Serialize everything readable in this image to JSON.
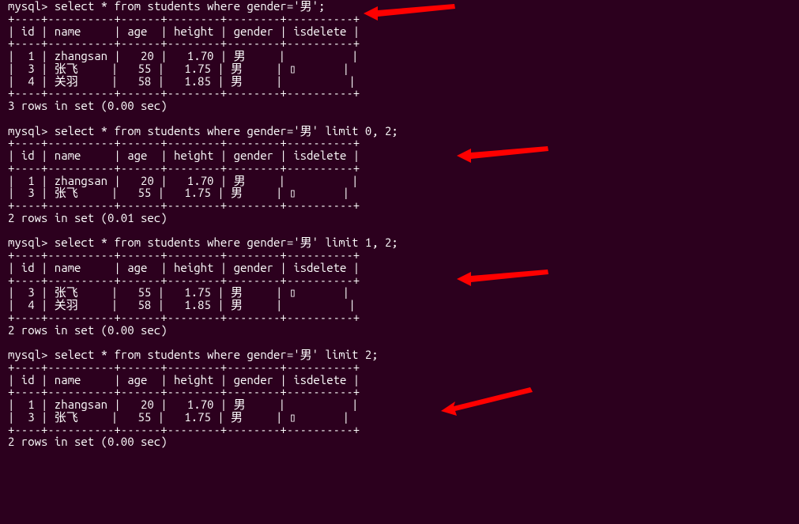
{
  "prompt": "mysql>",
  "queries": {
    "q1": "select * from students where gender='男';",
    "q2": "select * from students where gender='男' limit 0, 2;",
    "q3": "select * from students where gender='男' limit 1, 2;",
    "q4": "select * from students where gender='男' limit 2;"
  },
  "table_sep": "+----+----------+------+--------+--------+----------+",
  "table_hdr": "| id | name     | age  | height | gender | isdelete |",
  "rows": {
    "r1": "|  1 | zhangsan |   20 |   1.70 | 男     |          |",
    "r3": "|  3 | 张飞     |   55 |   1.75 | 男     | ▯       |",
    "r4": "|  4 | 关羽     |   58 |   1.85 | 男     |          |"
  },
  "footers": {
    "f3_000": "3 rows in set (0.00 sec)",
    "f2_001": "2 rows in set (0.01 sec)",
    "f2_000": "2 rows in set (0.00 sec)"
  },
  "blank": ""
}
